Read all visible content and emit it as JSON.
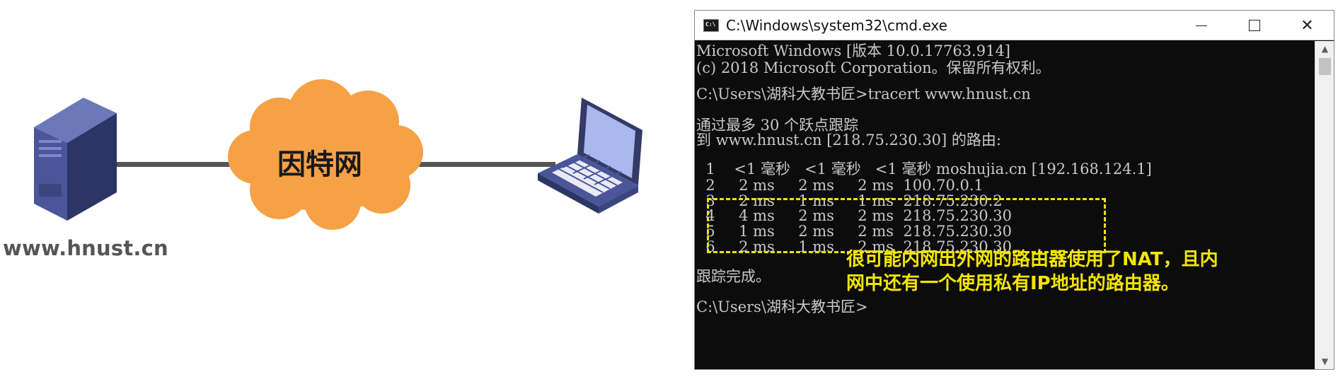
{
  "diagram": {
    "server_label": "www.hnust.cn",
    "cloud_label": "因特网",
    "colors": {
      "server": "#3c467e",
      "cloud": "#f7a146",
      "link": "#555555",
      "laptop_screen": "#aab8ef",
      "laptop_body": "#333b66"
    }
  },
  "window": {
    "title": "C:\\Windows\\system32\\cmd.exe",
    "icon_text": "C:\\",
    "minimize_icon": "minimize-icon",
    "maximize_icon": "maximize-icon",
    "close_label": "✕"
  },
  "console": {
    "lines": [
      "Microsoft Windows [版本 10.0.17763.914]",
      "(c) 2018 Microsoft Corporation。保留所有权利。",
      "",
      "C:\\Users\\湖科大教书匠>tracert www.hnust.cn",
      "",
      "通过最多 30 个跃点跟踪",
      "到 www.hnust.cn [218.75.230.30] 的路由:",
      "",
      "  1    <1 毫秒   <1 毫秒   <1 毫秒 moshujia.cn [192.168.124.1]",
      "  2     2 ms     2 ms     2 ms  100.70.0.1",
      "  3     2 ms     1 ms     1 ms  218.75.230.2",
      "  4     4 ms     2 ms     2 ms  218.75.230.30",
      "  5     1 ms     2 ms     2 ms  218.75.230.30",
      "  6     2 ms     1 ms     2 ms  218.75.230.30",
      "",
      "跟踪完成。",
      "",
      "C:\\Users\\湖科大教书匠>"
    ],
    "text_color": "#c8c8c8",
    "highlight_color": "#f0e000"
  },
  "annotation": {
    "line1": "很可能内网出外网的路由器使用了NAT，且内",
    "line2": "网中还有一个使用私有IP地址的路由器。"
  },
  "scrollbar": {
    "up_label": "▲",
    "down_label": "▼"
  }
}
